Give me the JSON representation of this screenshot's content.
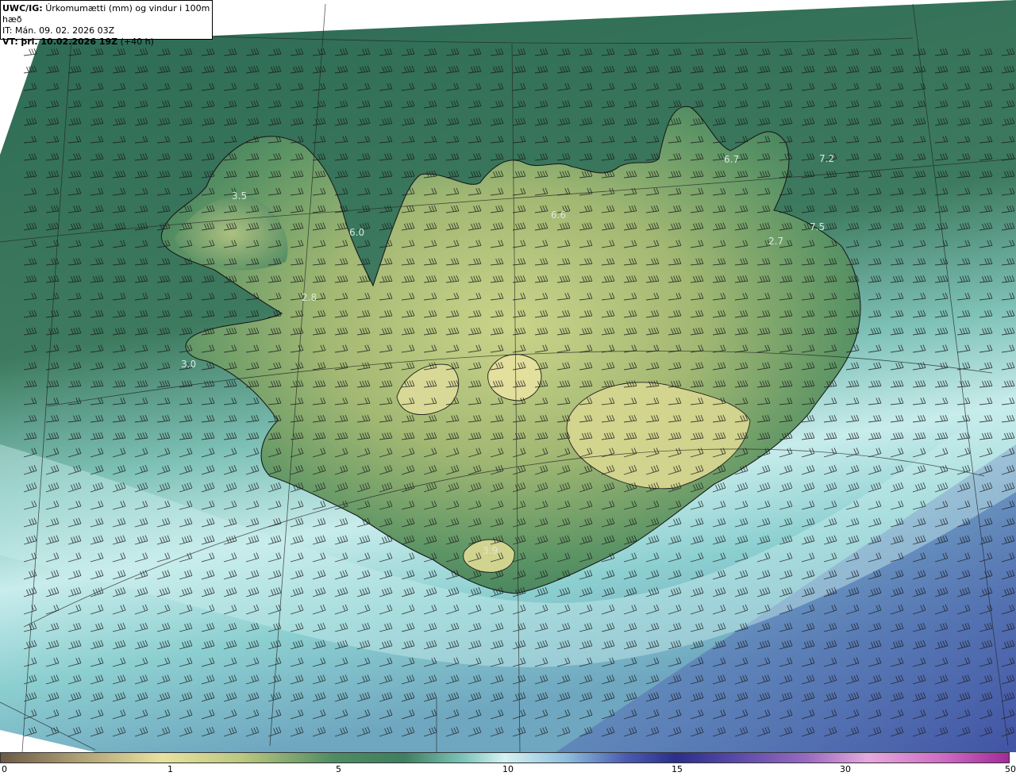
{
  "header": {
    "model": "UWC/IG:",
    "title": "Úrkomumætti (mm) og vindur i 100m hæð",
    "it_line": "IT: Mán. 09. 02. 2026 03Z",
    "vt_prefix": "VT:",
    "vt_date": "þri. 10.02.2026 19Z",
    "vt_offset": "(+40 h)"
  },
  "colors": {
    "ocean_dark": "#2e6b52",
    "land_low": "#4a8a60",
    "land_high": "#c9d486",
    "land_peak": "#e2df9a",
    "precip_light": "#9fd9d6",
    "precip_mid": "#cfeff0",
    "precip_heavy": "#4a57a8",
    "coast": "#1a1a1a",
    "grid": "#222222",
    "label": "#d8e4dc"
  },
  "colorbar": {
    "ticks": [
      {
        "label": "0",
        "value": 0
      },
      {
        "label": "1",
        "value": 1
      },
      {
        "label": "5",
        "value": 5
      },
      {
        "label": "10",
        "value": 10
      },
      {
        "label": "15",
        "value": 15
      },
      {
        "label": "30",
        "value": 30
      },
      {
        "label": "50",
        "value": 50
      }
    ]
  },
  "map_labels": [
    {
      "text": "6.7"
    },
    {
      "text": "7.2"
    },
    {
      "text": "6.6"
    },
    {
      "text": "3.5"
    },
    {
      "text": "6.0"
    },
    {
      "text": "7.5"
    },
    {
      "text": "2.7"
    },
    {
      "text": "2.8"
    },
    {
      "text": "3.0"
    },
    {
      "text": "3.9"
    }
  ]
}
